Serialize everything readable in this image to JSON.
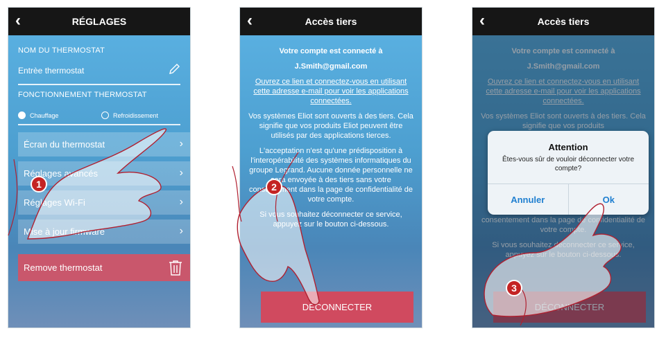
{
  "screen1": {
    "title": "RÉGLAGES",
    "thermostat_name_label": "NOM DU THERMOSTAT",
    "thermostat_name_value": "Entrèe thermostat",
    "mode_label": "FONCTIONNEMENT THERMOSTAT",
    "mode_options": [
      {
        "label": "Chauffage",
        "selected": true
      },
      {
        "label": "Refroidissement",
        "selected": false
      }
    ],
    "menu_items": [
      {
        "label": "Écran du thermostat"
      },
      {
        "label": "Réglages avancés"
      },
      {
        "label": "Réglages Wi-Fi"
      },
      {
        "label": "Mise à jour firmware"
      }
    ],
    "remove_label": "Remove thermostat",
    "step_badge": "1"
  },
  "screen2": {
    "title": "Accès tiers",
    "connected_line": "Votre compte est connecté à",
    "email": "J.Smith@gmail.com",
    "link_text": "Ouvrez ce lien et connectez-vous en utilisant cette adresse e-mail pour voir les applications connectées.",
    "para1": "Vos systèmes Eliot sont ouverts à des tiers. Cela signifie que vos produits Eliot peuvent être utilisés par des applications tierces.",
    "para2": "L'acceptation n'est qu'une prédisposition à l'interopérabilité des systèmes informatiques du groupe Legrand. Aucune donnée personnelle ne sera envoyée à des tiers sans votre consentement dans la page de confidentialité de votre compte.",
    "para3": "Si vous souhaitez déconnecter ce service, appuyez sur le bouton ci-dessous.",
    "disconnect_label": "DÉCONNECTER",
    "step_badge": "2"
  },
  "screen3": {
    "title": "Accès tiers",
    "connected_line": "Votre compte est connecté à",
    "email": "J.Smith@gmail.com",
    "link_text": "Ouvrez ce lien et connectez-vous en utilisant cette adresse e-mail pour voir les applications connectées.",
    "para1": "Vos systèmes Eliot sont ouverts à des tiers. Cela signifie que vos produits",
    "para2": "consentement dans la page de confidentialité de votre compte.",
    "para3": "Si vous souhaitez déconnecter ce service, appuyez sur le bouton ci-dessous.",
    "disconnect_label": "DÉCONNECTER",
    "dialog": {
      "title": "Attention",
      "message": "Êtes-vous sûr de vouloir déconnecter votre compte?",
      "cancel_label": "Annuler",
      "ok_label": "Ok"
    },
    "step_badge": "3"
  },
  "colors": {
    "header": "#161616",
    "gradient_top": "#5cb3e4",
    "gradient_bottom": "#6f8fb8",
    "danger": "#d04a5f",
    "badge": "#c42424",
    "dialog_button": "#1f7fd0"
  }
}
